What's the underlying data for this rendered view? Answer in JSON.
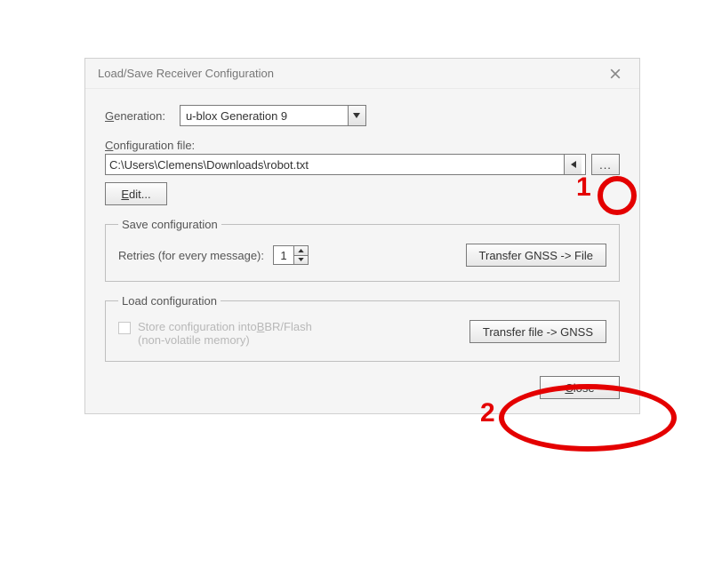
{
  "dialog": {
    "title": "Load/Save Receiver Configuration"
  },
  "generation": {
    "label_pre": "",
    "label_text": "Generation:",
    "underline_char": "G",
    "rest": "eneration:",
    "selected": "u-blox Generation 9"
  },
  "config_file": {
    "label_underline": "C",
    "label_rest": "onfiguration file:",
    "value": "C:\\Users\\Clemens\\Downloads\\robot.txt",
    "browse_label": "..."
  },
  "edit": {
    "label_underline": "E",
    "label_rest": "dit..."
  },
  "save_group": {
    "legend": "Save configuration",
    "retries_label": "Retries (for every message):",
    "retries_value": "1",
    "button_label": "Transfer GNSS -> File"
  },
  "load_group": {
    "legend": "Load configuration",
    "store_pre": "Store configuration into",
    "store_underline": "B",
    "store_mid": "BR/Flash",
    "store_sub": "(non-volatile memory)",
    "button_label": "Transfer file -> GNSS"
  },
  "footer": {
    "close_underline": "C",
    "close_rest": "lose"
  },
  "annotations": {
    "num1": "1",
    "num2": "2"
  }
}
